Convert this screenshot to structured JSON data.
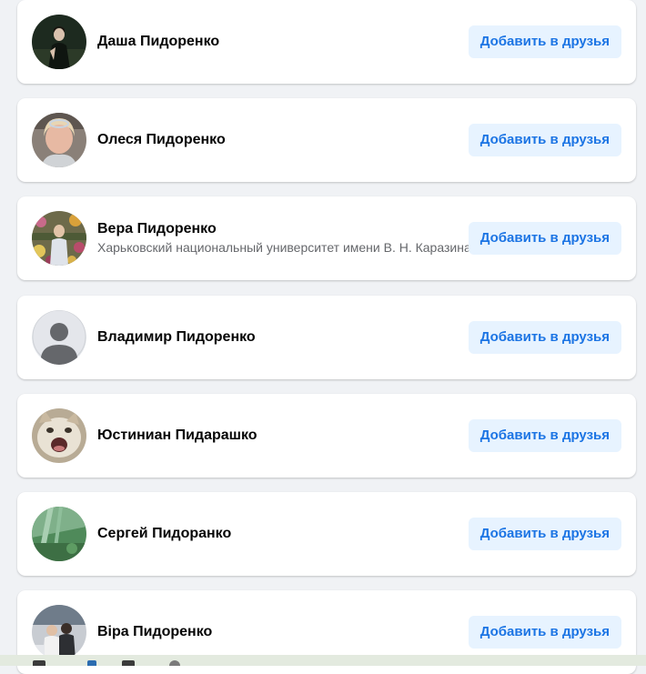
{
  "people": [
    {
      "name": "Даша Пидоренко",
      "subtitle": "",
      "button": "Добавить в друзья",
      "avatar": "photo-dark-portrait-icon"
    },
    {
      "name": "Олеся Пидоренко",
      "subtitle": "",
      "button": "Добавить в друзья",
      "avatar": "photo-woman-blonde-icon"
    },
    {
      "name": "Вера Пидоренко",
      "subtitle": "Харьковский национальный университет имени В. Н. Каразина",
      "button": "Добавить в друзья",
      "avatar": "photo-flowers-icon"
    },
    {
      "name": "Владимир Пидоренко",
      "subtitle": "",
      "button": "Добавить в друзья",
      "avatar": "default-avatar-icon"
    },
    {
      "name": "Юстиниан Пидарашко",
      "subtitle": "",
      "button": "Добавить в друзья",
      "avatar": "photo-cat-icon"
    },
    {
      "name": "Сергей Пидоранко",
      "subtitle": "",
      "button": "Добавить в друзья",
      "avatar": "photo-green-landscape-icon"
    },
    {
      "name": "Віра Пидоренко",
      "subtitle": "",
      "button": "Добавить в друзья",
      "avatar": "photo-group-icon"
    }
  ],
  "colors": {
    "page_background": "#f0f2f5",
    "card_background": "#ffffff",
    "button_background": "#e7f3ff",
    "button_text": "#1b74e4",
    "name_text": "#050505",
    "subtitle_text": "#65676b"
  }
}
